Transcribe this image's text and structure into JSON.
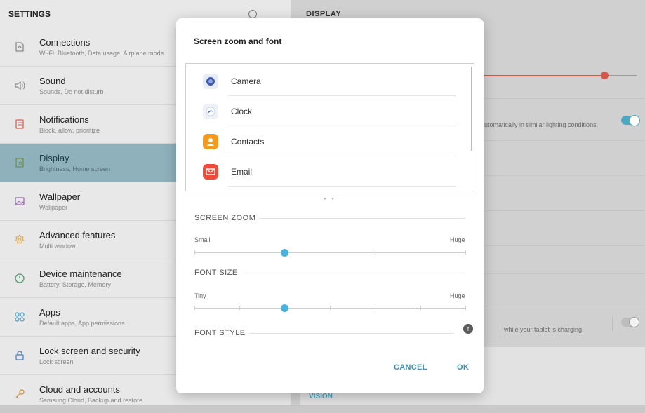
{
  "settings": {
    "header": "SETTINGS",
    "items": [
      {
        "title": "Connections",
        "subtitle": "Wi-Fi, Bluetooth, Data usage, Airplane mode",
        "icon": "connections-icon"
      },
      {
        "title": "Sound",
        "subtitle": "Sounds, Do not disturb",
        "icon": "sound-icon"
      },
      {
        "title": "Notifications",
        "subtitle": "Block, allow, prioritize",
        "icon": "notifications-icon"
      },
      {
        "title": "Display",
        "subtitle": "Brightness, Home screen",
        "icon": "display-icon",
        "active": true
      },
      {
        "title": "Wallpaper",
        "subtitle": "Wallpaper",
        "icon": "wallpaper-icon"
      },
      {
        "title": "Advanced features",
        "subtitle": "Multi window",
        "icon": "advanced-features-icon"
      },
      {
        "title": "Device maintenance",
        "subtitle": "Battery, Storage, Memory",
        "icon": "device-maintenance-icon"
      },
      {
        "title": "Apps",
        "subtitle": "Default apps, App permissions",
        "icon": "apps-icon"
      },
      {
        "title": "Lock screen and security",
        "subtitle": "Lock screen",
        "icon": "lock-icon"
      },
      {
        "title": "Cloud and accounts",
        "subtitle": "Samsung Cloud, Backup and restore",
        "icon": "key-icon"
      }
    ]
  },
  "display_pane": {
    "header": "DISPLAY",
    "adaptive_text": "utomatically in similar lighting conditions.",
    "charging_text": "while your tablet is charging.",
    "bottom_label": "VISION"
  },
  "dialog": {
    "title": "Screen zoom and font",
    "apps": [
      {
        "name": "Camera",
        "icon": "camera-icon",
        "color": "#e8ecf5"
      },
      {
        "name": "Clock",
        "icon": "clock-icon",
        "color": "#eef1f6"
      },
      {
        "name": "Contacts",
        "icon": "contacts-icon",
        "color": "#f39a1f"
      },
      {
        "name": "Email",
        "icon": "email-icon",
        "color": "#ee4c3b"
      }
    ],
    "screen_zoom": {
      "label": "SCREEN ZOOM",
      "min_label": "Small",
      "max_label": "Huge",
      "level": 1,
      "steps": 4
    },
    "font_size": {
      "label": "FONT SIZE",
      "min_label": "Tiny",
      "max_label": "Huge",
      "level": 2,
      "steps": 7
    },
    "font_style": {
      "label": "FONT STYLE"
    },
    "cancel_label": "CANCEL",
    "ok_label": "OK"
  },
  "colors": {
    "accent": "#4ab3dd",
    "brightness": "#d2584a",
    "active_item": "#8fb1bb"
  }
}
